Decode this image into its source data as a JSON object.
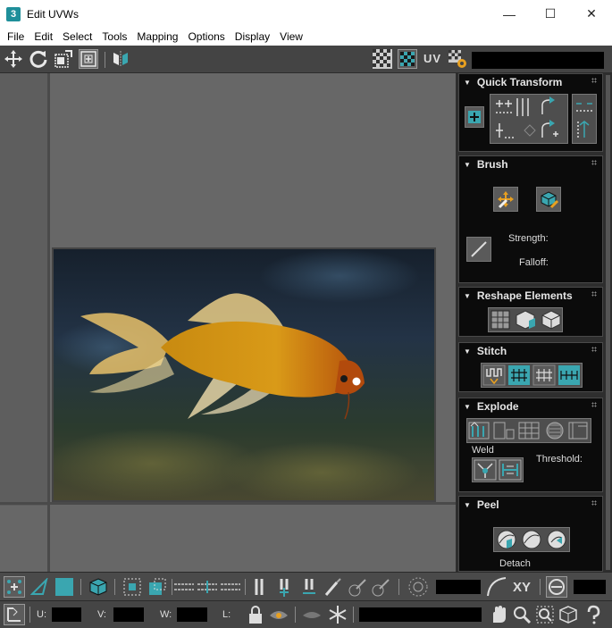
{
  "window": {
    "title": "Edit UVWs",
    "app_icon_text": "3",
    "minimize_glyph": "—",
    "maximize_glyph": "☐",
    "close_glyph": "✕"
  },
  "menu": {
    "items": [
      "File",
      "Edit",
      "Select",
      "Tools",
      "Mapping",
      "Options",
      "Display",
      "View"
    ]
  },
  "top_toolbar": {
    "uv_label": "UV",
    "icons": [
      "move-icon",
      "rotate-icon",
      "scale-icon",
      "freeform-icon",
      "mirror-icon",
      "checker-pattern-icon",
      "checker-map-icon",
      "texture-settings-icon"
    ],
    "texture_dropdown_value": ""
  },
  "viewport": {
    "image_subject": "goldfish"
  },
  "panels": {
    "quick_transform": {
      "title": "Quick Transform"
    },
    "brush": {
      "title": "Brush",
      "strength_label": "Strength:",
      "falloff_label": "Falloff:"
    },
    "reshape": {
      "title": "Reshape Elements"
    },
    "stitch": {
      "title": "Stitch"
    },
    "explode": {
      "title": "Explode",
      "weld_label": "Weld",
      "threshold_label": "Threshold:"
    },
    "peel": {
      "title": "Peel",
      "detach_label": "Detach"
    }
  },
  "bottom_toolbar": {
    "xy_label": "XY",
    "u_label": "U:",
    "v_label": "V:",
    "w_label": "W:",
    "l_label": "L:",
    "u_value": "",
    "v_value": "",
    "w_value": "",
    "l_value": ""
  },
  "colors": {
    "accent_teal": "#3aa6b0",
    "panel_bg": "#0b0b0b",
    "viewport_bg": "#676767"
  }
}
